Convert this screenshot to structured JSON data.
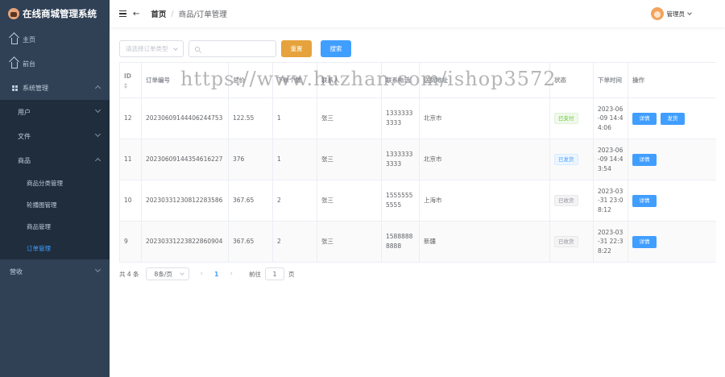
{
  "app": {
    "title": "在线商城管理系统"
  },
  "sidebar": {
    "items": [
      {
        "label": "主页"
      },
      {
        "label": "前台"
      },
      {
        "label": "系统管理"
      },
      {
        "label": "用户"
      },
      {
        "label": "文件"
      },
      {
        "label": "商品"
      },
      {
        "label": "商品分类管理"
      },
      {
        "label": "轮播图管理"
      },
      {
        "label": "商品管理"
      },
      {
        "label": "订单管理"
      },
      {
        "label": "营收"
      }
    ],
    "active_color": "#409eff",
    "bg_color": "#304156"
  },
  "header": {
    "breadcrumb_home": "首页",
    "breadcrumb_sep": "/",
    "breadcrumb_current": "商品/订单管理",
    "username": "管理员"
  },
  "toolbar": {
    "order_type_placeholder": "请选择订单类型",
    "search_placeholder": "",
    "reset_label": "重置",
    "search_label": "搜索",
    "reset_color": "#e6a23c",
    "search_color": "#409eff"
  },
  "table": {
    "columns": [
      "ID",
      "订单编号",
      "总价",
      "下单个数",
      "联系人",
      "联系电话",
      "送货地址",
      "状态",
      "下单时间",
      "操作"
    ],
    "rows": [
      {
        "id": "12",
        "order_no": "20230609144406244753",
        "total": "122.55",
        "count": "1",
        "contact": "张三",
        "phone": "13333333333",
        "address": "北京市",
        "status": "已支付",
        "time": "2023-06-09 14:44:06",
        "actions": [
          "详情",
          "发货"
        ]
      },
      {
        "id": "11",
        "order_no": "20230609144354616227",
        "total": "376",
        "count": "1",
        "contact": "张三",
        "phone": "13333333333",
        "address": "北京市",
        "status": "已发货",
        "time": "2023-06-09 14:43:54",
        "actions": [
          "详情"
        ]
      },
      {
        "id": "10",
        "order_no": "20230331230812283586",
        "total": "367.65",
        "count": "2",
        "contact": "张三",
        "phone": "15555555555",
        "address": "上海市",
        "status": "已收货",
        "time": "2023-03-31 23:08:12",
        "actions": [
          "详情"
        ]
      },
      {
        "id": "9",
        "order_no": "20230331223822860904",
        "total": "367.65",
        "count": "2",
        "contact": "张三",
        "phone": "15888888888",
        "address": "新疆",
        "status": "已收货",
        "time": "2023-03-31 22:38:22",
        "actions": [
          "详情"
        ]
      }
    ]
  },
  "pagination": {
    "total_label": "共 4 条",
    "page_size": "8条/页",
    "prev_icon": "‹",
    "current_page": "1",
    "next_icon": "›",
    "goto_label": "前往",
    "goto_value": "1",
    "page_unit": "页"
  },
  "watermark": "https://www.huzhan.com/ishop3572"
}
